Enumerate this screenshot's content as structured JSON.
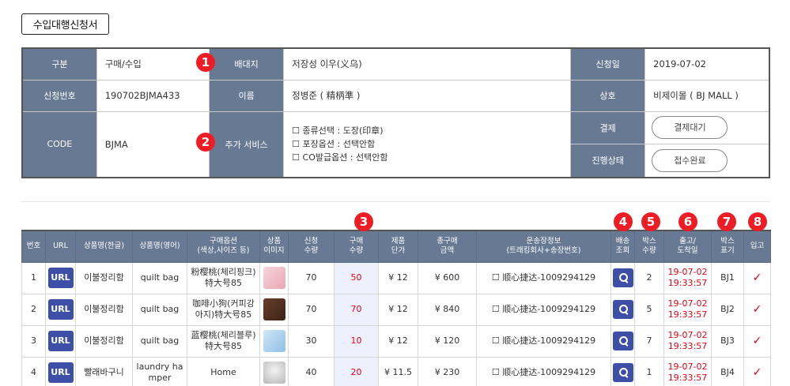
{
  "page_title": "수입대행신청서",
  "info": {
    "r1": {
      "l1": "구분",
      "v1": "구매/수입",
      "l2": "배대지",
      "v2": "저장성 이우(义乌)",
      "l3": "신청일",
      "v3": "2019-07-02"
    },
    "r2": {
      "l1": "신청번호",
      "v1": "190702BJMA433",
      "l2": "이름",
      "v2": "정병준 ( 精柄準 )",
      "l3": "상호",
      "v3": "비제이몰 ( BJ MALL )"
    },
    "r3": {
      "l1": "CODE",
      "v1": "BJMA",
      "l2": "추가 서비스",
      "services": [
        "☐ 종류선택 : 도장(印章)",
        "☐ 포장옵션 : 선택안함",
        "☐ CO발급옵션 : 선택안함"
      ],
      "l3a": "결제",
      "btn_payment": "결제대기",
      "l3b": "진행상태",
      "btn_status": "접수완료"
    }
  },
  "badges": [
    "1",
    "2",
    "3",
    "4",
    "5",
    "6",
    "7",
    "8"
  ],
  "table": {
    "headers": [
      {
        "l1": "번호",
        "l2": ""
      },
      {
        "l1": "URL",
        "l2": ""
      },
      {
        "l1": "상품명(한글)",
        "l2": ""
      },
      {
        "l1": "상품명(영어)",
        "l2": ""
      },
      {
        "l1": "구매옵션",
        "l2": "(색상,사이즈 등)"
      },
      {
        "l1": "상품",
        "l2": "이미지"
      },
      {
        "l1": "신청",
        "l2": "수량"
      },
      {
        "l1": "구매",
        "l2": "수량"
      },
      {
        "l1": "제품",
        "l2": "단가"
      },
      {
        "l1": "총구매",
        "l2": "금액"
      },
      {
        "l1": "운송장정보",
        "l2": "(트래킹회사+송장번호)"
      },
      {
        "l1": "배송",
        "l2": "조회"
      },
      {
        "l1": "박스",
        "l2": "수량"
      },
      {
        "l1": "출고/",
        "l2": "도착일"
      },
      {
        "l1": "박스",
        "l2": "표기"
      },
      {
        "l1": "입고",
        "l2": ""
      }
    ],
    "url_label": "URL",
    "rows": [
      {
        "no": "1",
        "name_ko": "이불정리함",
        "name_en": "quilt bag",
        "opt1": "粉樱桃(체리핑크)",
        "opt2": "特大号85",
        "img": "pink",
        "req": "70",
        "buy": "50",
        "price": "¥ 12",
        "total": "¥ 600",
        "track": "☐ 顺心捷达-1009294129",
        "box": "2",
        "date1": "19-07-02",
        "date2": "19:33:57",
        "mark": "BJ1",
        "check": "✓"
      },
      {
        "no": "2",
        "name_ko": "이불정리함",
        "name_en": "quilt bag",
        "opt1": "咖啡小狗(커피강",
        "opt2": "아지)特大号85",
        "img": "brown",
        "req": "70",
        "buy": "70",
        "price": "¥ 12",
        "total": "¥ 840",
        "track": "☐ 顺心捷达-1009294129",
        "box": "5",
        "date1": "19-07-02",
        "date2": "19:33:57",
        "mark": "BJ2",
        "check": "✓"
      },
      {
        "no": "3",
        "name_ko": "이불정리함",
        "name_en": "quilt bag",
        "opt1": "蓝樱桃(체리블루)",
        "opt2": "特大号85",
        "img": "blue",
        "req": "30",
        "buy": "10",
        "price": "¥ 12",
        "total": "¥ 120",
        "track": "☐ 顺心捷达-1009294129",
        "box": "7",
        "date1": "19-07-02",
        "date2": "19:33:57",
        "mark": "BJ3",
        "check": "✓"
      },
      {
        "no": "4",
        "name_ko": "빨래바구니",
        "name_en": "laundry ha",
        "name_en2": "mper",
        "opt1": "Home",
        "opt2": "",
        "img": "gray",
        "req": "40",
        "buy": "20",
        "price": "¥ 11.5",
        "total": "¥ 230",
        "track": "☐ 顺心捷达-1009294129",
        "box": "1",
        "date1": "19-07-02",
        "date2": "19:33:57",
        "mark": "BJ4",
        "check": "✓"
      }
    ]
  }
}
